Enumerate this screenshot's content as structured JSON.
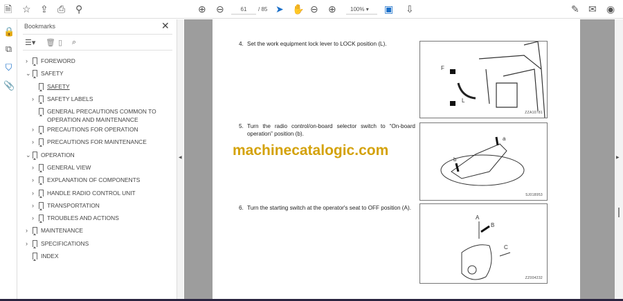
{
  "toolbar": {
    "page_current": "61",
    "page_total": "/ 85",
    "zoom": "100%"
  },
  "bookmarks": {
    "title": "Bookmarks",
    "items": [
      {
        "label": "FOREWORD"
      },
      {
        "label": "SAFETY"
      },
      {
        "label": "SAFETY"
      },
      {
        "label": "SAFETY LABELS"
      },
      {
        "label": "GENERAL PRECAUTIONS COMMON TO",
        "label2": "OPERATION AND MAINTENANCE"
      },
      {
        "label": "PRECAUTIONS FOR OPERATION"
      },
      {
        "label": "PRECAUTIONS FOR MAINTENANCE"
      },
      {
        "label": "OPERATION"
      },
      {
        "label": "GENERAL VIEW"
      },
      {
        "label": "EXPLANATION OF COMPONENTS"
      },
      {
        "label": "HANDLE RADIO CONTROL UNIT"
      },
      {
        "label": "TRANSPORTATION"
      },
      {
        "label": "TROUBLES AND ACTIONS"
      },
      {
        "label": "MAINTENANCE"
      },
      {
        "label": "SPECIFICATIONS"
      },
      {
        "label": "INDEX"
      }
    ]
  },
  "document": {
    "steps": [
      {
        "num": "4.",
        "text": "Set the work equipment lock lever to LOCK position (L).",
        "figure_code": "ZZA10781",
        "labels": [
          "F",
          "L"
        ]
      },
      {
        "num": "5.",
        "text": "Turn the radio control/on-board selector switch to “On-board operation” position (b).",
        "figure_code": "SJ018953",
        "labels": [
          "a",
          "b"
        ]
      },
      {
        "num": "6.",
        "text": "Turn the starting switch at the operator's seat to OFF position (A).",
        "figure_code": "ZZ004232",
        "labels": [
          "A",
          "B",
          "C"
        ]
      }
    ],
    "watermark": "machinecatalogic.com"
  }
}
